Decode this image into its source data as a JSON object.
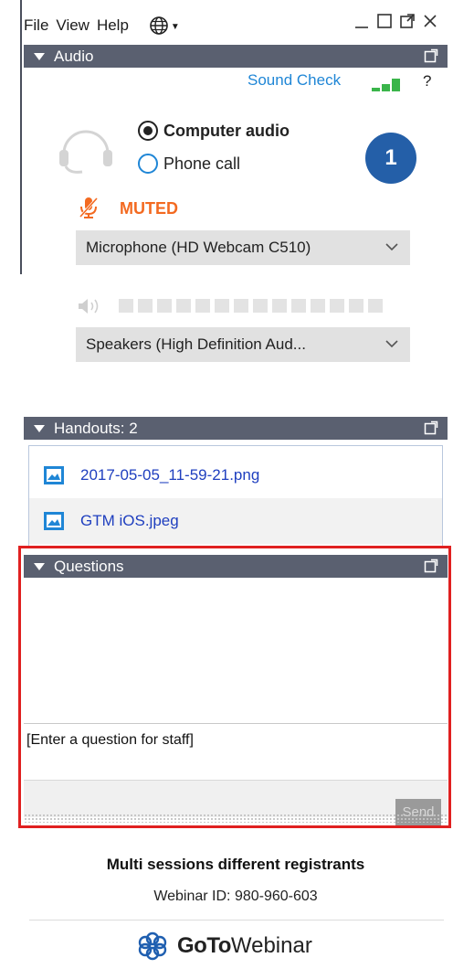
{
  "menubar": {
    "items": [
      "File",
      "View",
      "Help"
    ],
    "language_icon": "globe-icon",
    "window_controls": [
      "minimize-icon",
      "maximize-icon",
      "popout-icon",
      "close-icon"
    ]
  },
  "audio": {
    "header": "Audio",
    "sound_check": "Sound Check",
    "help": "?",
    "options": [
      {
        "label": "Computer audio",
        "selected": true
      },
      {
        "label": "Phone call",
        "selected": false
      }
    ],
    "status": "MUTED",
    "microphone": "Microphone (HD Webcam C510)",
    "speakers": "Speakers (High Definition Aud...",
    "badge": "1",
    "signal_strength": 3,
    "speaker_level": 0
  },
  "handouts": {
    "header": "Handouts: 2",
    "files": [
      {
        "name": "2017-05-05_11-59-21.png"
      },
      {
        "name": "GTM iOS.jpeg"
      }
    ]
  },
  "questions": {
    "header": "Questions",
    "placeholder": "[Enter a question for staff]",
    "send_label": "Send"
  },
  "footer": {
    "session_title": "Multi sessions different registrants",
    "webinar_id": "Webinar ID: 980-960-603",
    "brand_bold": "GoTo",
    "brand_light": "Webinar"
  },
  "colors": {
    "header_bar": "#5a6070",
    "link": "#1f86d6",
    "muted": "#f36a21",
    "badge": "#245fa8",
    "highlight": "#e02020"
  }
}
